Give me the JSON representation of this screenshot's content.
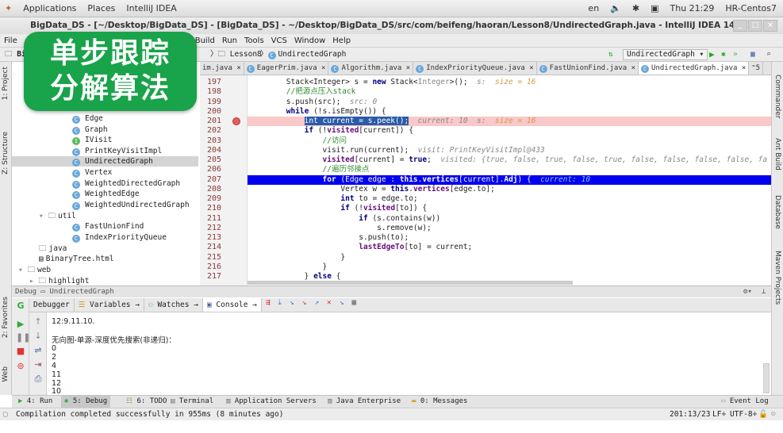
{
  "topbar": {
    "applications": "Applications",
    "places": "Places",
    "app": "IntelliJ IDEA",
    "lang": "en",
    "time": "Thu 21:29",
    "host": "HR-Centos7"
  },
  "window": {
    "title": "BigData_DS - [~/Desktop/BigData_DS] - [BigData_DS] - ~/Desktop/BigData_DS/src/com/beifeng/haoran/Lesson8/UndirectedGraph.java - IntelliJ IDEA 14.1.1"
  },
  "menu": [
    "File",
    "Build",
    "Run",
    "Tools",
    "VCS",
    "Window",
    "Help"
  ],
  "nav": {
    "project": "Bi",
    "crumb1": "Lesson8",
    "crumb2": "UndirectedGraph",
    "run_config": "UndirectedGraph"
  },
  "tabs": [
    {
      "label": "im.java"
    },
    {
      "label": "EagerPrim.java"
    },
    {
      "label": "Algorithm.java"
    },
    {
      "label": "IndexPriorityQueue.java"
    },
    {
      "label": "FastUnionFind.java"
    },
    {
      "label": "UndirectedGraph.java",
      "active": true
    }
  ],
  "overlay": {
    "line1": "单步跟踪",
    "line2": "分解算法"
  },
  "left_stripe": {
    "project": "1: Project",
    "structure": "Z: Structure",
    "favorites": "2: Favorites",
    "web": "Web"
  },
  "right_stripe": {
    "commander": "Commander",
    "ant": "Ant Build",
    "database": "Database",
    "maven": "Maven Projects"
  },
  "tree": [
    {
      "label": "Edge",
      "type": "class",
      "depth": 3
    },
    {
      "label": "Graph",
      "type": "class",
      "depth": 3
    },
    {
      "label": "IVisit",
      "type": "interface",
      "depth": 3
    },
    {
      "label": "PrintKeyVisitImpl",
      "type": "class",
      "depth": 3
    },
    {
      "label": "UndirectedGraph",
      "type": "class",
      "depth": 3,
      "selected": true
    },
    {
      "label": "Vertex",
      "type": "class",
      "depth": 3
    },
    {
      "label": "WeightedDirectedGraph",
      "type": "class",
      "depth": 3
    },
    {
      "label": "WeightedEdge",
      "type": "class",
      "depth": 3
    },
    {
      "label": "WeightedUndirectedGraph",
      "type": "class",
      "depth": 3
    },
    {
      "label": "util",
      "type": "folder-open",
      "depth": 2
    },
    {
      "label": "FastUnionFind",
      "type": "class",
      "depth": 3
    },
    {
      "label": "IndexPriorityQueue",
      "type": "class",
      "depth": 3
    },
    {
      "label": "java",
      "type": "folder",
      "depth": 1
    },
    {
      "label": "BinaryTree.html",
      "type": "file",
      "depth": 1
    },
    {
      "label": "web",
      "type": "folder-open",
      "depth": 0
    },
    {
      "label": "highlight",
      "type": "folder-closed",
      "depth": 1
    }
  ],
  "editor": {
    "first_line": 197,
    "breakpoint_line": 201,
    "current_line": 207,
    "lines": [
      [
        [
          "n",
          "        Stack<Integer> s = "
        ],
        [
          "k",
          "new"
        ],
        [
          "n",
          " Stack<"
        ],
        [
          "g",
          "Integer"
        ],
        [
          "n",
          ">();  "
        ],
        [
          "h",
          "s:  "
        ],
        [
          "hv",
          "size = 16"
        ]
      ],
      [
        [
          "c",
          "        //把源点压入stack"
        ]
      ],
      [
        [
          "n",
          "        s.push(src);  "
        ],
        [
          "h",
          "src: 0"
        ]
      ],
      [
        [
          "k",
          "        while"
        ],
        [
          "n",
          " (!s.isEmpty()) {"
        ]
      ],
      [
        [
          "n",
          "            "
        ],
        [
          "sel",
          "int current = s.peek();"
        ],
        [
          "n",
          "  "
        ],
        [
          "h",
          "current: 10  s:  "
        ],
        [
          "hv",
          "size = 16"
        ]
      ],
      [
        [
          "k",
          "            if"
        ],
        [
          "n",
          " (!"
        ],
        [
          "f",
          "visited"
        ],
        [
          "n",
          "[current]) {"
        ]
      ],
      [
        [
          "c",
          "                //访问"
        ]
      ],
      [
        [
          "n",
          "                visit.run(current);  "
        ],
        [
          "h",
          "visit: PrintKeyVisitImpl@433"
        ]
      ],
      [
        [
          "f",
          "                visited"
        ],
        [
          "n",
          "[current] = "
        ],
        [
          "k",
          "true"
        ],
        [
          "n",
          ";  "
        ],
        [
          "h",
          "visited: {true, false, true, false, true, false, false, false, false, fa"
        ]
      ],
      [
        [
          "c",
          "                //遍历邻接点"
        ]
      ],
      [
        [
          "k",
          "                for"
        ],
        [
          "n",
          " (Edge edge : "
        ],
        [
          "k",
          "this"
        ],
        [
          "n",
          "."
        ],
        [
          "f",
          "vertices"
        ],
        [
          "n",
          "[current]."
        ],
        [
          "f",
          "Adj"
        ],
        [
          "n",
          ") {  "
        ],
        [
          "h",
          "current: 10"
        ]
      ],
      [
        [
          "n",
          "                    Vertex w = "
        ],
        [
          "k",
          "this"
        ],
        [
          "n",
          "."
        ],
        [
          "f",
          "vertices"
        ],
        [
          "n",
          "[edge.to];"
        ]
      ],
      [
        [
          "k",
          "                    int"
        ],
        [
          "n",
          " to = edge.to;"
        ]
      ],
      [
        [
          "k",
          "                    if"
        ],
        [
          "n",
          " (!"
        ],
        [
          "f",
          "visited"
        ],
        [
          "n",
          "[to]) {"
        ]
      ],
      [
        [
          "k",
          "                        if"
        ],
        [
          "n",
          " (s.contains(w))"
        ]
      ],
      [
        [
          "n",
          "                            s.remove(w);"
        ]
      ],
      [
        [
          "n",
          "                        s.push(to);"
        ]
      ],
      [
        [
          "f",
          "                        lastEdgeTo"
        ],
        [
          "n",
          "[to] = current;"
        ]
      ],
      [
        [
          "n",
          "                    }"
        ]
      ],
      [
        [
          "n",
          "                }"
        ]
      ],
      [
        [
          "n",
          "            } "
        ],
        [
          "k",
          "else"
        ],
        [
          "n",
          " {"
        ]
      ]
    ]
  },
  "debug": {
    "header_label": "Debug",
    "config": "UndirectedGraph",
    "tabs": [
      "Debugger",
      "Variables",
      "Watches",
      "Console"
    ],
    "console": [
      "12:9.11.10.",
      "",
      "无向图-单源-深度优先搜索(非递归)：",
      "0",
      "2",
      "4",
      "11",
      "12",
      "10"
    ]
  },
  "bottombar": {
    "run": "4: Run",
    "debug": "5: Debug",
    "todo": "6: TODO",
    "terminal": "Terminal",
    "app_servers": "Application Servers",
    "java_ee": "Java Enterprise",
    "messages": "0: Messages",
    "event_log": "Event Log"
  },
  "status": {
    "message": "Compilation completed successfully in 955ms (8 minutes ago)",
    "position": "201:13/23",
    "line_sep": "LF",
    "encoding": "UTF-8"
  },
  "colors": {
    "overlay": "#19a34a",
    "current_line": "#0000ee",
    "breakpoint_line": "#f9c8c8"
  }
}
